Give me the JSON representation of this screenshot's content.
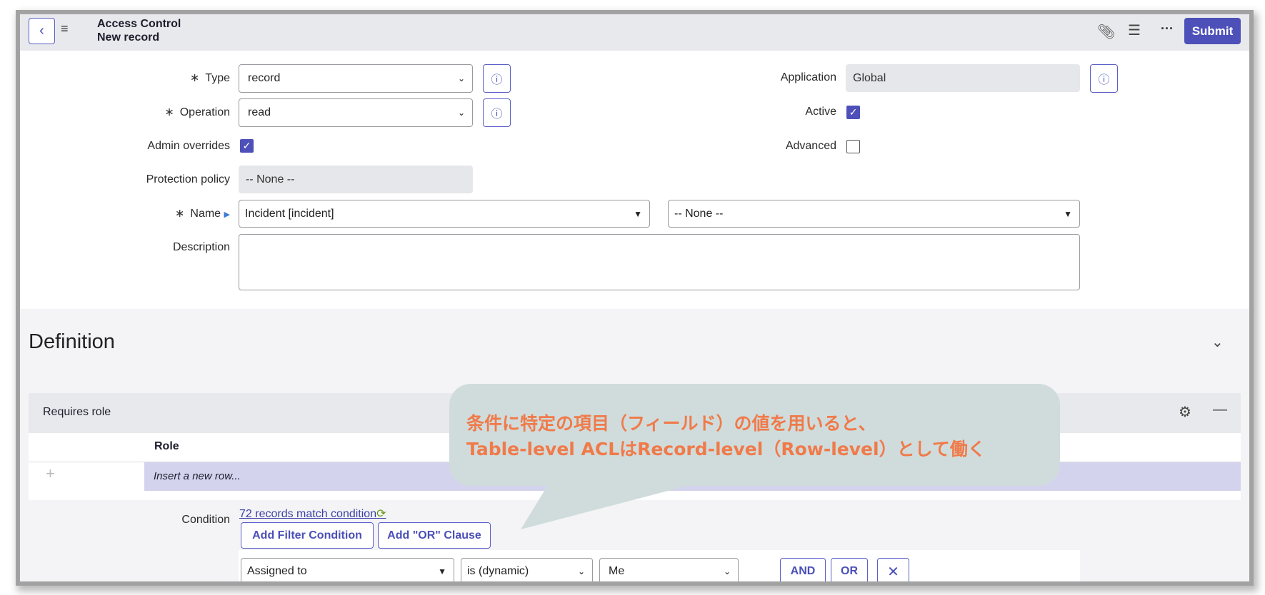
{
  "header": {
    "title": "Access Control",
    "subtitle": "New record",
    "submit": "Submit"
  },
  "form": {
    "type": {
      "label": "Type",
      "value": "record"
    },
    "operation": {
      "label": "Operation",
      "value": "read"
    },
    "admin_overrides": {
      "label": "Admin overrides",
      "checked": true
    },
    "protection_policy": {
      "label": "Protection policy",
      "value": "-- None --"
    },
    "name": {
      "label": "Name",
      "table": "Incident [incident]",
      "field": "-- None --"
    },
    "description": {
      "label": "Description",
      "value": ""
    },
    "application": {
      "label": "Application",
      "value": "Global"
    },
    "active": {
      "label": "Active",
      "checked": true
    },
    "advanced": {
      "label": "Advanced",
      "checked": false
    },
    "required_mark": "∗"
  },
  "definition": {
    "title": "Definition"
  },
  "requires_role": {
    "title": "Requires role",
    "column": "Role",
    "insert_placeholder": "Insert a new row..."
  },
  "condition": {
    "label": "Condition",
    "match_link": "72 records match condition",
    "add_filter": "Add Filter Condition",
    "add_or": "Add \"OR\" Clause",
    "field": "Assigned to",
    "operator": "is (dynamic)",
    "value": "Me",
    "and": "AND",
    "or": "OR"
  },
  "callout": {
    "line1": "条件に特定の項目（フィールド）の値を用いると、",
    "line2": "Table-level ACLはRecord-level（Row-level）として働く",
    "color": "#f07a4a"
  }
}
